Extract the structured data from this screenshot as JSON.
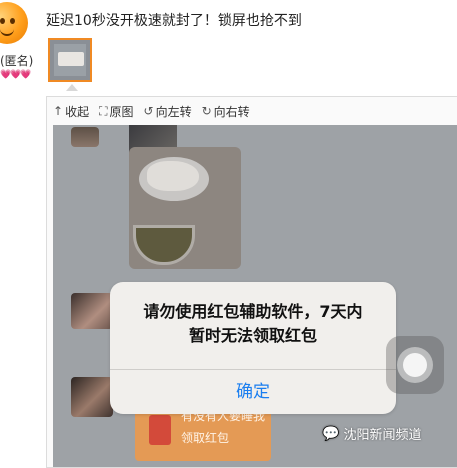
{
  "post": {
    "text": "延迟10秒没开极速就封了！锁屏也抢不到",
    "author": "(匿名)",
    "badges": "💗💗💗"
  },
  "viewer": {
    "toolbar": [
      {
        "icon": "↑",
        "label": "收起"
      },
      {
        "icon": "⛶",
        "label": "原图"
      },
      {
        "icon": "↺",
        "label": "向左转"
      },
      {
        "icon": "↻",
        "label": "向右转"
      }
    ]
  },
  "screenshot": {
    "chat_message": {
      "line1": "有没有人要睡我",
      "line2": "领取红包"
    },
    "dialog": {
      "line1": "请勿使用红包辅助软件，7天内",
      "line2": "暂时无法领取红包",
      "button": "确定",
      "button_color": "#1a7ef0"
    },
    "watermark": {
      "icon": "wechat-icon",
      "text": "沈阳新闻频道"
    }
  },
  "colors": {
    "thumb_border": "#f08a24",
    "red_packet": "#e49a55"
  }
}
